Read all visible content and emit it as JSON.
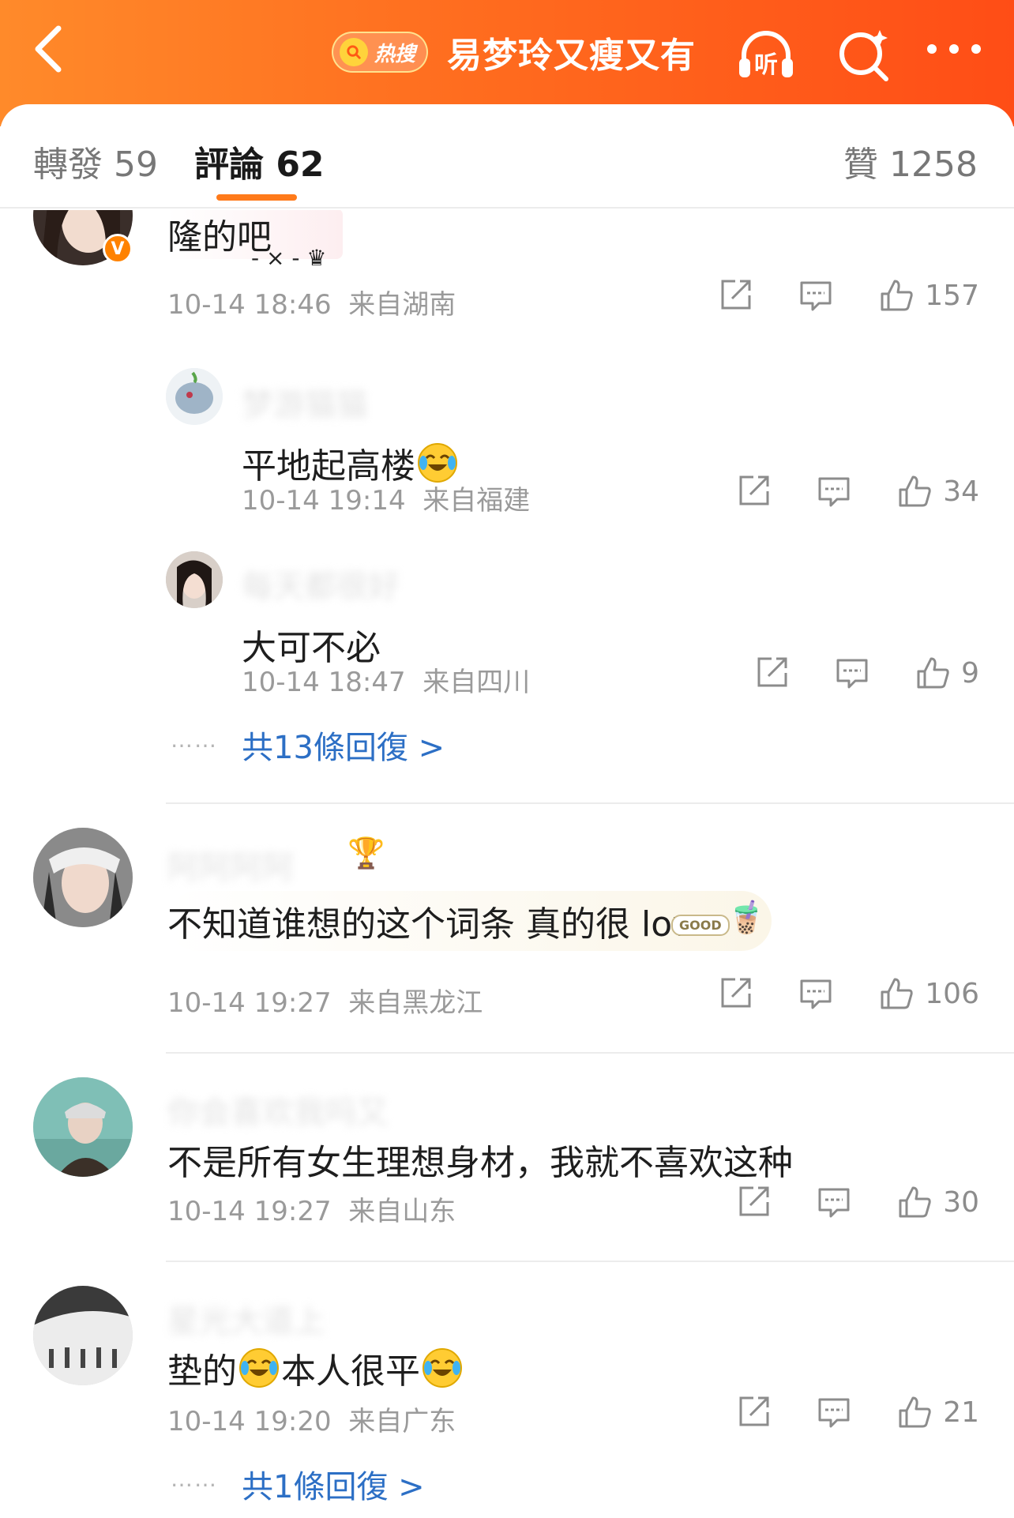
{
  "header": {
    "hot_label": "热搜",
    "title": "易梦玲又瘦又有"
  },
  "tabs": {
    "repost": "轉發 59",
    "comment": "評論 62",
    "like": "贊 1258"
  },
  "comments": [
    {
      "text": "隆的吧",
      "time": "10-14 18:46",
      "location": "来自湖南",
      "likes": "157",
      "replies": [
        {
          "name": "梦游猫猫",
          "text": "平地起高楼",
          "time": "10-14 19:14",
          "location": "来自福建",
          "likes": "34"
        },
        {
          "name": "每天都很好",
          "text": "大可不必",
          "time": "10-14 18:47",
          "location": "来自四川",
          "likes": "9"
        }
      ],
      "more_replies": "共13條回復 >"
    },
    {
      "name": "阿阿阿阿",
      "text": "不知道谁想的这个词条 真的很 low",
      "time": "10-14 19:27",
      "location": "来自黑龙江",
      "likes": "106"
    },
    {
      "name": "你会喜欢我吗又",
      "text": "不是所有女生理想身材，我就不喜欢这种",
      "time": "10-14 19:27",
      "location": "来自山东",
      "likes": "30"
    },
    {
      "name": "星光大道上",
      "text_a": "垫的",
      "text_b": "本人很平",
      "time": "10-14 19:20",
      "location": "来自广东",
      "likes": "21",
      "more_replies": "共1條回復 >"
    }
  ],
  "dots": "……",
  "sticker_text": "GOOD",
  "colors": {
    "accent_orange": "#ff6d1f",
    "link_blue": "#2c6fc5",
    "meta_gray": "#9a9a9a"
  },
  "icons": [
    "back-icon",
    "listen-icon",
    "search-icon",
    "more-icon",
    "share-icon",
    "comment-icon",
    "thumb-up-icon",
    "laugh-cry-emoji"
  ]
}
